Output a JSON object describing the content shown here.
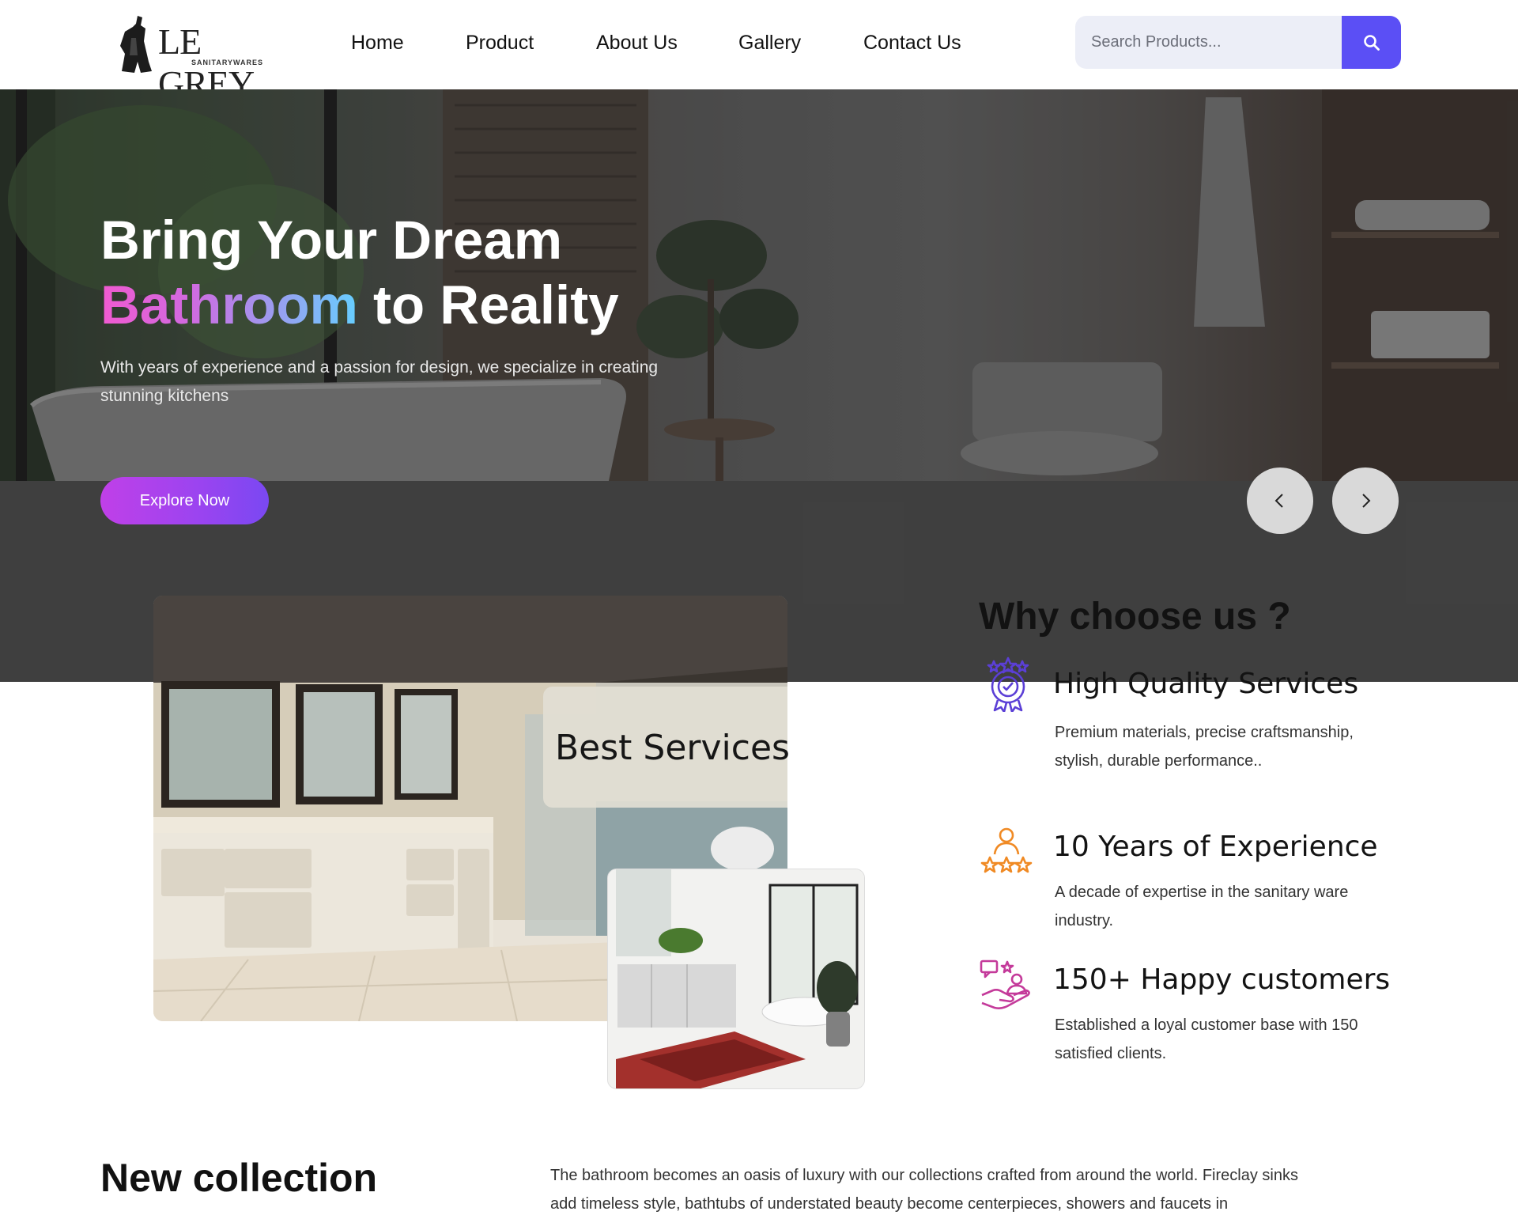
{
  "brand": {
    "name": "LE GREY",
    "tagline": "SANITARYWARES"
  },
  "nav": {
    "items": [
      {
        "label": "Home"
      },
      {
        "label": "Product"
      },
      {
        "label": "About Us"
      },
      {
        "label": "Gallery"
      },
      {
        "label": "Contact Us"
      }
    ]
  },
  "search": {
    "placeholder": "Search Products..."
  },
  "hero": {
    "title_line1": "Bring Your Dream",
    "title_highlight": "Bathroom",
    "title_rest": " to Reality",
    "subtitle": "With years of experience and a passion for design, we specialize in creating stunning kitchens",
    "cta_label": "Explore Now",
    "prev_icon": "chevron-left-icon",
    "next_icon": "chevron-right-icon"
  },
  "why": {
    "image_badge": "Best Services",
    "title": "Why choose us ?",
    "features": [
      {
        "icon": "award-medal-icon",
        "title": "High Quality Services",
        "desc": "Premium materials, precise craftsmanship, stylish, durable performance..",
        "color": "#5b3fd6"
      },
      {
        "icon": "experience-stars-icon",
        "title": "10 Years of Experience",
        "desc": "A decade of expertise in the sanitary ware industry.",
        "color": "#f08a24"
      },
      {
        "icon": "happy-customers-icon",
        "title": "150+ Happy customers",
        "desc": "Established a loyal customer base with 150 satisfied clients.",
        "color": "#c43a9a"
      }
    ]
  },
  "collection": {
    "title": "New collection",
    "text": "The bathroom becomes an oasis of luxury with our collections crafted from around the world. Fireclay sinks add timeless style, bathtubs of understated beauty become centerpieces, showers and faucets in"
  },
  "colors": {
    "accent": "#5b4ff5",
    "cta_gradient_start": "#c040e8",
    "cta_gradient_end": "#7a48f2"
  }
}
